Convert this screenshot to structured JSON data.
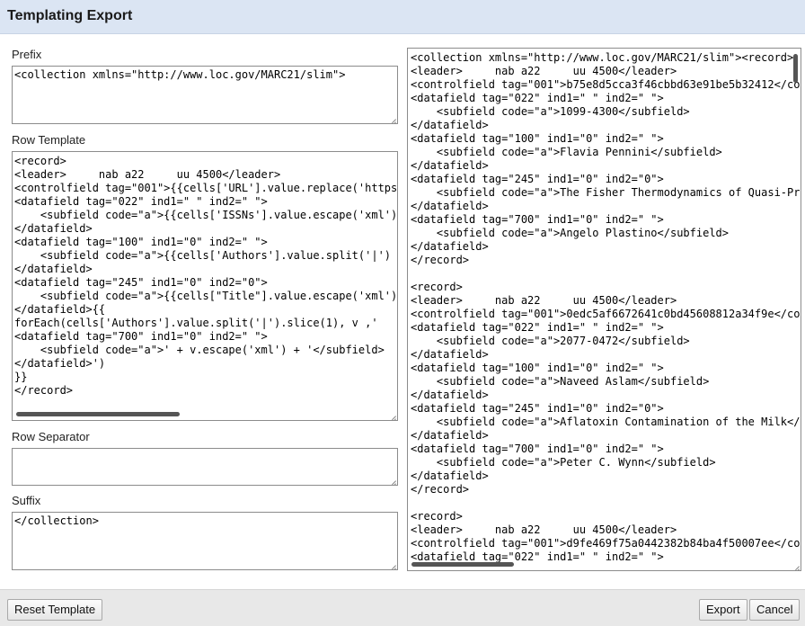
{
  "dialog": {
    "title": "Templating Export"
  },
  "prefix": {
    "label": "Prefix",
    "value": "<collection xmlns=\"http://www.loc.gov/MARC21/slim\">"
  },
  "row_template": {
    "label": "Row Template",
    "value": "<record>\n<leader>     nab a22     uu 4500</leader>\n<controlfield tag=\"001\">{{cells['URL'].value.replace('https\n<datafield tag=\"022\" ind1=\" \" ind2=\" \">\n    <subfield code=\"a\">{{cells['ISSNs'].value.escape('xml')\n</datafield>\n<datafield tag=\"100\" ind1=\"0\" ind2=\" \">\n    <subfield code=\"a\">{{cells['Authors'].value.split('|')\n</datafield>\n<datafield tag=\"245\" ind1=\"0\" ind2=\"0\">\n    <subfield code=\"a\">{{cells[\"Title\"].value.escape('xml')\n</datafield>{{\nforEach(cells['Authors'].value.split('|').slice(1), v ,'\n<datafield tag=\"700\" ind1=\"0\" ind2=\" \">\n    <subfield code=\"a\">' + v.escape('xml') + '</subfield>\n</datafield>')\n}}\n</record>"
  },
  "row_separator": {
    "label": "Row Separator",
    "value": ""
  },
  "suffix": {
    "label": "Suffix",
    "value": "</collection>"
  },
  "preview": {
    "value": "<collection xmlns=\"http://www.loc.gov/MARC21/slim\"><record>\n<leader>     nab a22     uu 4500</leader>\n<controlfield tag=\"001\">b75e8d5cca3f46cbbd63e91be5b32412</controlfield>\n<datafield tag=\"022\" ind1=\" \" ind2=\" \">\n    <subfield code=\"a\">1099-4300</subfield>\n</datafield>\n<datafield tag=\"100\" ind1=\"0\" ind2=\" \">\n    <subfield code=\"a\">Flavia Pennini</subfield>\n</datafield>\n<datafield tag=\"245\" ind1=\"0\" ind2=\"0\">\n    <subfield code=\"a\">The Fisher Thermodynamics of Quasi-Probabilities</subfield>\n</datafield>\n<datafield tag=\"700\" ind1=\"0\" ind2=\" \">\n    <subfield code=\"a\">Angelo Plastino</subfield>\n</datafield>\n</record>\n\n<record>\n<leader>     nab a22     uu 4500</leader>\n<controlfield tag=\"001\">0edc5af6672641c0bd45608812a34f9e</controlfield>\n<datafield tag=\"022\" ind1=\" \" ind2=\" \">\n    <subfield code=\"a\">2077-0472</subfield>\n</datafield>\n<datafield tag=\"100\" ind1=\"0\" ind2=\" \">\n    <subfield code=\"a\">Naveed Aslam</subfield>\n</datafield>\n<datafield tag=\"245\" ind1=\"0\" ind2=\"0\">\n    <subfield code=\"a\">Aflatoxin Contamination of the Milk</subfield>\n</datafield>\n<datafield tag=\"700\" ind1=\"0\" ind2=\" \">\n    <subfield code=\"a\">Peter C. Wynn</subfield>\n</datafield>\n</record>\n\n<record>\n<leader>     nab a22     uu 4500</leader>\n<controlfield tag=\"001\">d9fe469f75a0442382b84ba4f50007ee</controlfield>\n<datafield tag=\"022\" ind1=\" \" ind2=\" \">"
  },
  "buttons": {
    "reset": "Reset Template",
    "export": "Export",
    "cancel": "Cancel"
  }
}
